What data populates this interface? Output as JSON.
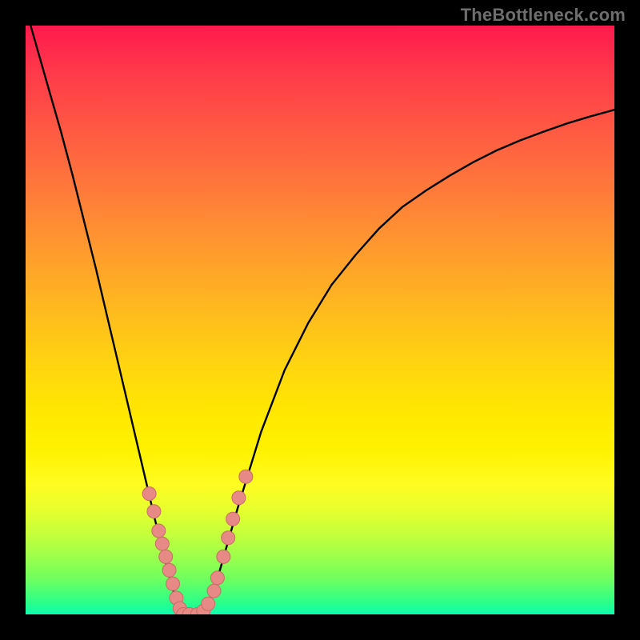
{
  "watermark": "TheBottleneck.com",
  "colors": {
    "frame": "#000000",
    "curve": "#000000",
    "marker_fill": "#e78a86",
    "marker_stroke": "#c86b66",
    "band": "#1fe07a"
  },
  "chart_data": {
    "type": "line",
    "title": "",
    "xlabel": "",
    "ylabel": "",
    "xlim": [
      0,
      1
    ],
    "ylim": [
      0,
      1
    ],
    "grid": false,
    "legend": false,
    "series": [
      {
        "name": "bottleneck-curve",
        "x": [
          0.0,
          0.02,
          0.04,
          0.06,
          0.08,
          0.1,
          0.12,
          0.14,
          0.16,
          0.18,
          0.2,
          0.22,
          0.24,
          0.255,
          0.268,
          0.278,
          0.288,
          0.3,
          0.32,
          0.34,
          0.36,
          0.38,
          0.4,
          0.44,
          0.48,
          0.52,
          0.56,
          0.6,
          0.64,
          0.68,
          0.72,
          0.76,
          0.8,
          0.84,
          0.88,
          0.92,
          0.96,
          1.0
        ],
        "y": [
          1.03,
          0.96,
          0.89,
          0.82,
          0.745,
          0.665,
          0.585,
          0.5,
          0.415,
          0.33,
          0.245,
          0.16,
          0.08,
          0.025,
          0.0,
          0.0,
          0.0,
          0.005,
          0.04,
          0.11,
          0.18,
          0.245,
          0.31,
          0.415,
          0.495,
          0.56,
          0.61,
          0.655,
          0.692,
          0.72,
          0.745,
          0.768,
          0.788,
          0.805,
          0.82,
          0.834,
          0.846,
          0.857
        ]
      }
    ],
    "markers": {
      "name": "data-points",
      "x": [
        0.21,
        0.218,
        0.226,
        0.232,
        0.238,
        0.244,
        0.25,
        0.256,
        0.262,
        0.268,
        0.278,
        0.292,
        0.302,
        0.31,
        0.32,
        0.326,
        0.336,
        0.344,
        0.352,
        0.362,
        0.374
      ],
      "y": [
        0.205,
        0.175,
        0.142,
        0.12,
        0.098,
        0.075,
        0.052,
        0.028,
        0.01,
        0.0,
        0.0,
        0.0,
        0.006,
        0.018,
        0.04,
        0.062,
        0.098,
        0.13,
        0.162,
        0.198,
        0.234
      ]
    },
    "annotations": []
  }
}
